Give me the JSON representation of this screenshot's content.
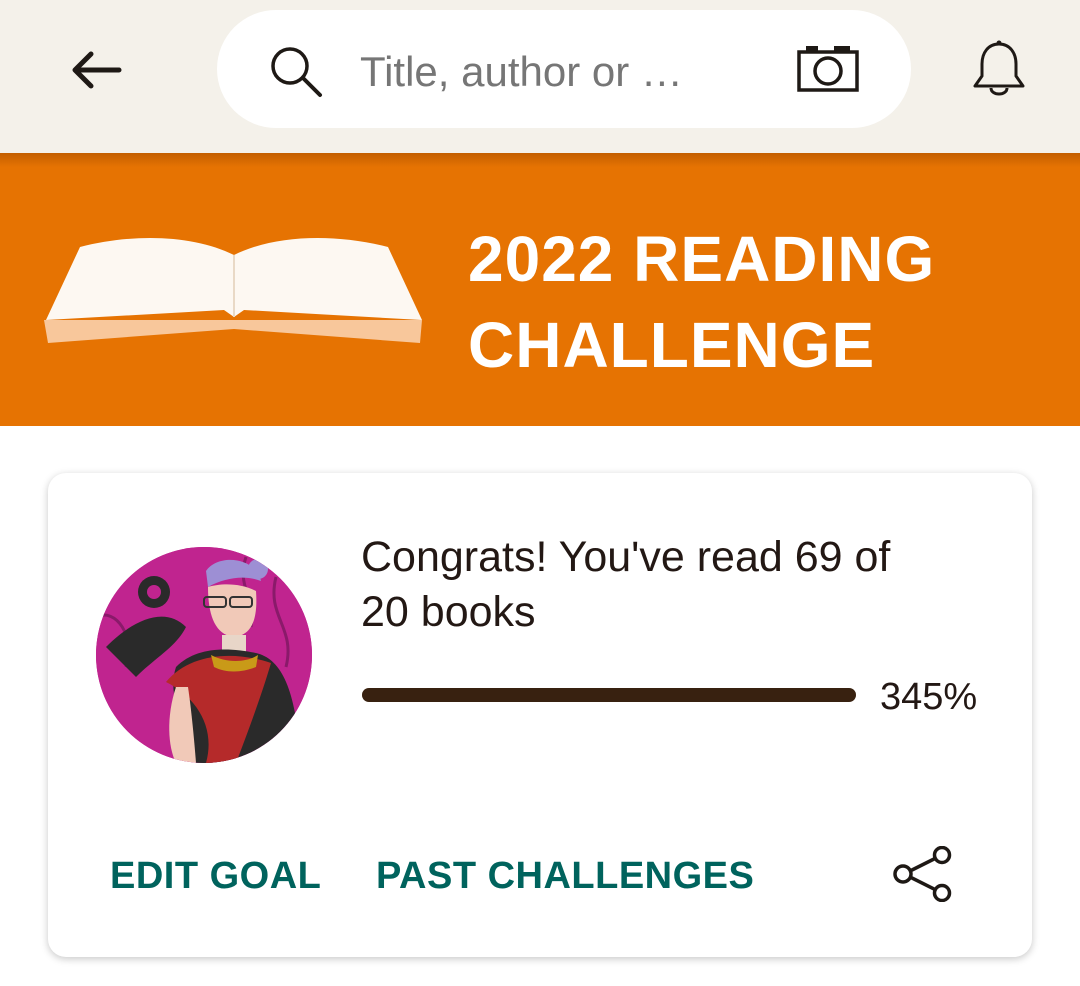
{
  "header": {
    "search": {
      "placeholder": "Title, author or …"
    },
    "icons": {
      "back": "arrow-left-icon",
      "search": "magnifier-icon",
      "camera": "camera-icon",
      "notifications": "bell-icon"
    }
  },
  "banner": {
    "title_line1": "2022 READING",
    "title_line2": "CHALLENGE",
    "icon": "open-book-icon"
  },
  "challenge": {
    "message_line1": "Congrats! You've read 69 of",
    "message_line2": "20 books",
    "books_read": 69,
    "goal": 20,
    "progress_percent_label": "345%",
    "progress_fraction": 1.0,
    "actions": {
      "edit_goal": "EDIT GOAL",
      "past_challenges": "PAST CHALLENGES"
    },
    "share_icon": "share-icon"
  },
  "colors": {
    "topbar_bg": "#f4f1ea",
    "banner_orange": "#e67302",
    "progress_fill": "#382110",
    "action_teal": "#00635d",
    "text_dark": "#231814"
  }
}
